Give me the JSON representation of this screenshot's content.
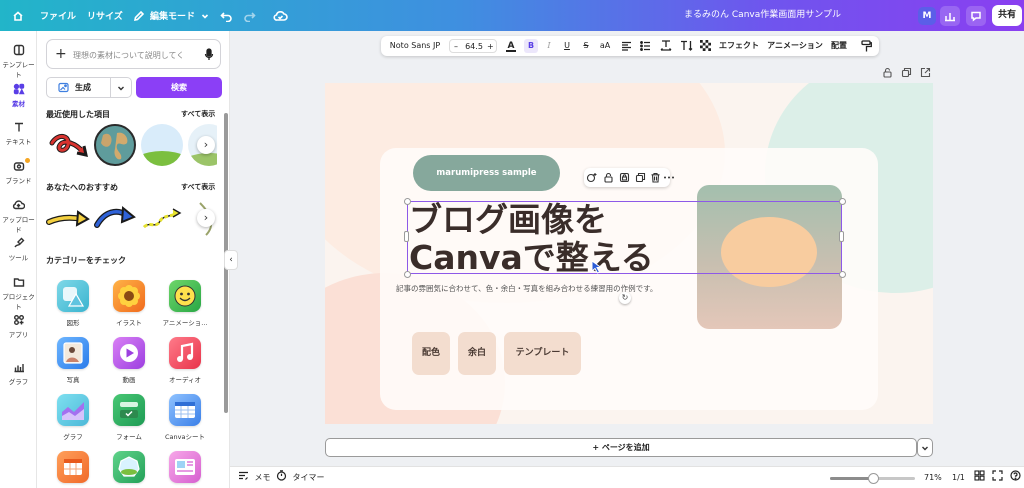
{
  "topbar": {
    "file_label": "ファイル",
    "resize_label": "リサイズ",
    "edit_mode_label": "編集モード",
    "doc_title": "まるみのん Canva作業画面用サンプル",
    "avatar_initial": "M",
    "share_label": "共有"
  },
  "rail": [
    {
      "label": "テンプレート"
    },
    {
      "label": "素材"
    },
    {
      "label": "テキスト"
    },
    {
      "label": "ブランド"
    },
    {
      "label": "アップロード"
    },
    {
      "label": "ツール"
    },
    {
      "label": "プロジェクト"
    },
    {
      "label": "アプリ"
    },
    {
      "label": "グラフ"
    }
  ],
  "panel": {
    "search_placeholder": "理想の素材について説明してく",
    "generate_label": "生成",
    "search_button": "検索",
    "recent_title": "最近使用した項目",
    "see_all": "すべて表示",
    "recommend_title": "あなたへのおすすめ",
    "category_title": "カテゴリーをチェック",
    "categories": [
      {
        "label": "図形"
      },
      {
        "label": "イラスト"
      },
      {
        "label": "アニメーショ..."
      },
      {
        "label": "写真"
      },
      {
        "label": "動画"
      },
      {
        "label": "オーディオ"
      },
      {
        "label": "グラフ"
      },
      {
        "label": "フォーム"
      },
      {
        "label": "Canvaシート"
      }
    ]
  },
  "format_bar": {
    "font_name": "Noto Sans JP",
    "decrease": "–",
    "font_size": "64.5",
    "increase": "+",
    "text_color_glyph": "A",
    "bold_glyph": "B",
    "italic_glyph": "I",
    "underline_glyph": "U",
    "strike_glyph": "S",
    "case_glyph": "aA",
    "effects_label": "エフェクト",
    "animation_label": "アニメーション",
    "position_label": "配置"
  },
  "design": {
    "pill_text": "marumipress sample",
    "headline_line1": "ブログ画像を",
    "headline_line2": "Canvaで整える",
    "subtext": "記事の雰囲気に合わせて、色・余白・写真を組み合わせる練習用の作例です。",
    "tags": [
      "配色",
      "余白",
      "テンプレート"
    ]
  },
  "add_page_label": "+ ページを追加",
  "bottombar": {
    "notes_label": "メモ",
    "timer_label": "タイマー",
    "zoom_percent": "71%",
    "zoom_level": 0.5,
    "page_indicator": "1/1"
  },
  "colors": {
    "accent": "#8b3ff6",
    "pill": "#86a89c",
    "tag": "#f3ddcf",
    "headline": "#3a2d2a"
  }
}
